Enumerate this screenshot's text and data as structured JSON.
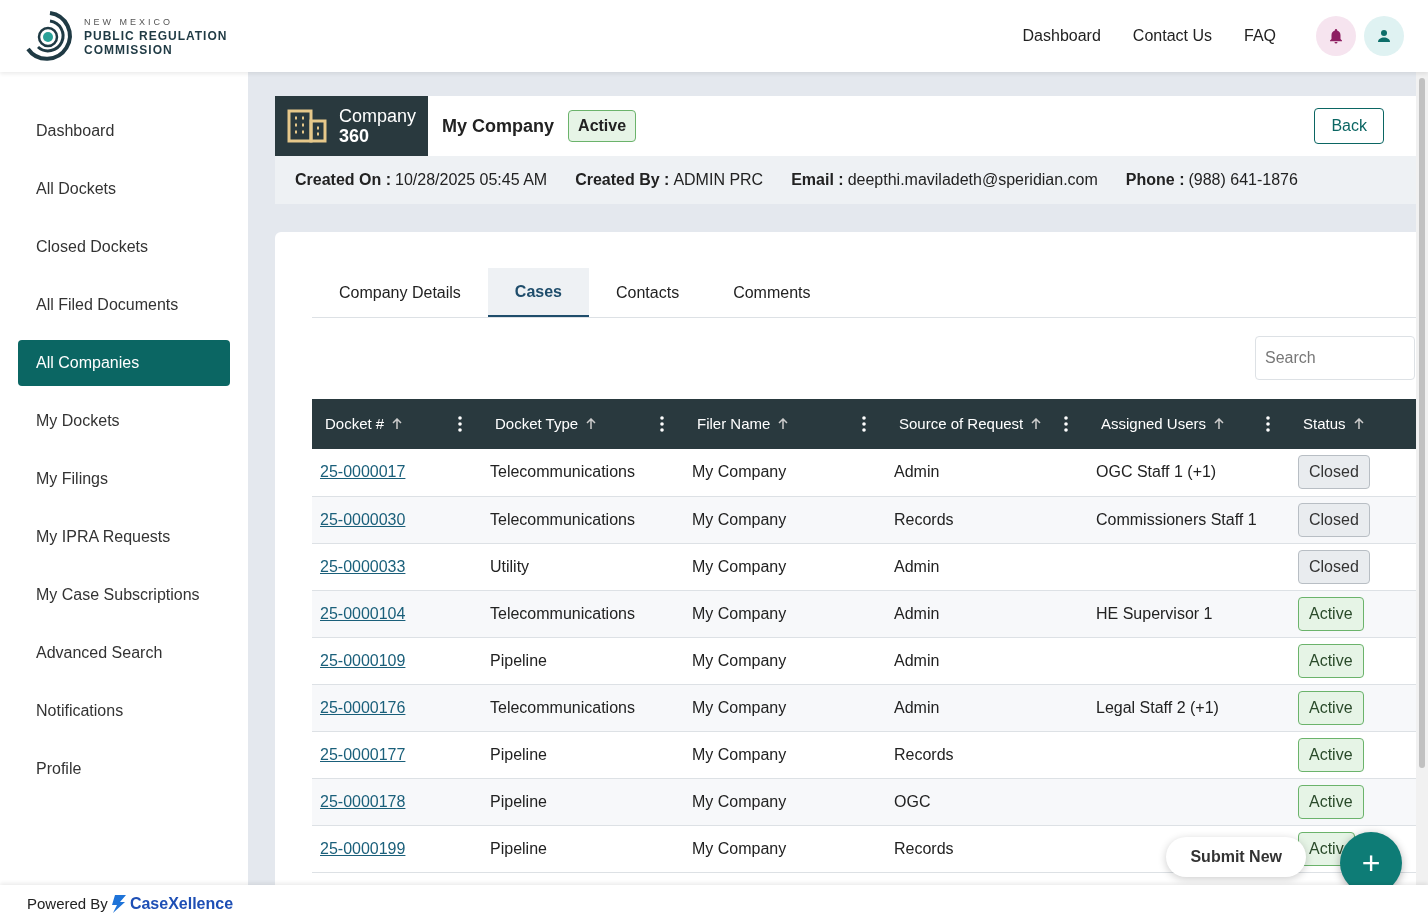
{
  "logo": {
    "top_line": "NEW MEXICO",
    "name_line_1": "PUBLIC REGULATION",
    "name_line_2": "COMMISSION"
  },
  "top_nav": [
    "Dashboard",
    "Contact Us",
    "FAQ"
  ],
  "sidebar": {
    "items": [
      {
        "label": "Dashboard",
        "selected": false
      },
      {
        "label": "All Dockets",
        "selected": false
      },
      {
        "label": "Closed Dockets",
        "selected": false
      },
      {
        "label": "All Filed Documents",
        "selected": false
      },
      {
        "label": "All Companies",
        "selected": true
      },
      {
        "label": "My Dockets",
        "selected": false
      },
      {
        "label": "My Filings",
        "selected": false
      },
      {
        "label": "My IPRA Requests",
        "selected": false
      },
      {
        "label": "My Case Subscriptions",
        "selected": false
      },
      {
        "label": "Advanced Search",
        "selected": false
      },
      {
        "label": "Notifications",
        "selected": false
      },
      {
        "label": "Profile",
        "selected": false
      }
    ]
  },
  "company_header": {
    "badge_line_1": "Company",
    "badge_line_2": "360",
    "name": "My Company",
    "status": "Active",
    "back_button": "Back",
    "details": [
      {
        "label": "Created On :",
        "value": "10/28/2025 05:45 AM"
      },
      {
        "label": "Created By :",
        "value": "ADMIN PRC"
      },
      {
        "label": "Email :",
        "value": "deepthi.maviladeth@speridian.com"
      },
      {
        "label": "Phone :",
        "value": "(988) 641-1876"
      }
    ]
  },
  "tabs": [
    {
      "label": "Company Details",
      "selected": false
    },
    {
      "label": "Cases",
      "selected": true
    },
    {
      "label": "Contacts",
      "selected": false
    },
    {
      "label": "Comments",
      "selected": false
    }
  ],
  "search": {
    "placeholder": "Search"
  },
  "table": {
    "columns": [
      "Docket #",
      "Docket Type",
      "Filer Name",
      "Source of Request",
      "Assigned Users",
      "Status"
    ],
    "rows": [
      {
        "docket": "25-0000017",
        "type": "Telecommunications",
        "filer": "My Company",
        "source": "Admin",
        "users": "OGC Staff 1 (+1)",
        "status": "Closed",
        "kind": "closed"
      },
      {
        "docket": "25-0000030",
        "type": "Telecommunications",
        "filer": "My Company",
        "source": "Records",
        "users": "Commissioners Staff 1",
        "status": "Closed",
        "kind": "closed"
      },
      {
        "docket": "25-0000033",
        "type": "Utility",
        "filer": "My Company",
        "source": "Admin",
        "users": "",
        "status": "Closed",
        "kind": "closed"
      },
      {
        "docket": "25-0000104",
        "type": "Telecommunications",
        "filer": "My Company",
        "source": "Admin",
        "users": "HE Supervisor 1",
        "status": "Active",
        "kind": "active"
      },
      {
        "docket": "25-0000109",
        "type": "Pipeline",
        "filer": "My Company",
        "source": "Admin",
        "users": "",
        "status": "Active",
        "kind": "active"
      },
      {
        "docket": "25-0000176",
        "type": "Telecommunications",
        "filer": "My Company",
        "source": "Admin",
        "users": "Legal Staff 2 (+1)",
        "status": "Active",
        "kind": "active"
      },
      {
        "docket": "25-0000177",
        "type": "Pipeline",
        "filer": "My Company",
        "source": "Records",
        "users": "",
        "status": "Active",
        "kind": "active"
      },
      {
        "docket": "25-0000178",
        "type": "Pipeline",
        "filer": "My Company",
        "source": "OGC",
        "users": "",
        "status": "Active",
        "kind": "active"
      },
      {
        "docket": "25-0000199",
        "type": "Pipeline",
        "filer": "My Company",
        "source": "Records",
        "users": "",
        "status": "Activ",
        "kind": "active"
      }
    ]
  },
  "submit_new": "Submit New",
  "fab": "+",
  "footer": {
    "powered_by": "Powered By",
    "brand": "CaseXellence"
  }
}
